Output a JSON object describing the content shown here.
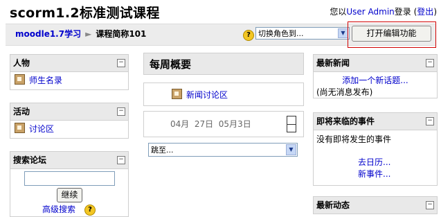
{
  "header": {
    "site_title": "scorm1.2标准测试课程",
    "login_prefix": "您以",
    "user_name": "User Admin",
    "login_suffix": "登录",
    "logout_open": " (",
    "logout_label": "登出",
    "logout_close": ")"
  },
  "navbar": {
    "crumb_home": "moodle1.7学习",
    "crumb_sep": "►",
    "crumb_current": "课程简称101",
    "role_select": "切换角色到...",
    "edit_button": "打开编辑功能"
  },
  "left": {
    "people": {
      "title": "人物",
      "items": [
        "师生名录"
      ]
    },
    "activities": {
      "title": "活动",
      "items": [
        "讨论区"
      ]
    },
    "search": {
      "title": "搜索论坛",
      "input_value": "",
      "go_button": "继续",
      "advanced": "高级搜索"
    }
  },
  "center": {
    "title": "每周概要",
    "news_forum": "新闻讨论区",
    "week_label": "04月  27日  05月3日",
    "jump_select": "跳至..."
  },
  "right": {
    "news": {
      "title": "最新新闻",
      "add_topic": "添加一个新话题...",
      "empty": "(尚无消息发布)"
    },
    "events": {
      "title": "即将来临的事件",
      "empty": "没有即将发生的事件",
      "calendar": "去日历...",
      "new_event": "新事件..."
    },
    "recent": {
      "title": "最新动态"
    }
  },
  "icons": {
    "collapse": "−",
    "help": "?",
    "dropdown": "▼"
  }
}
